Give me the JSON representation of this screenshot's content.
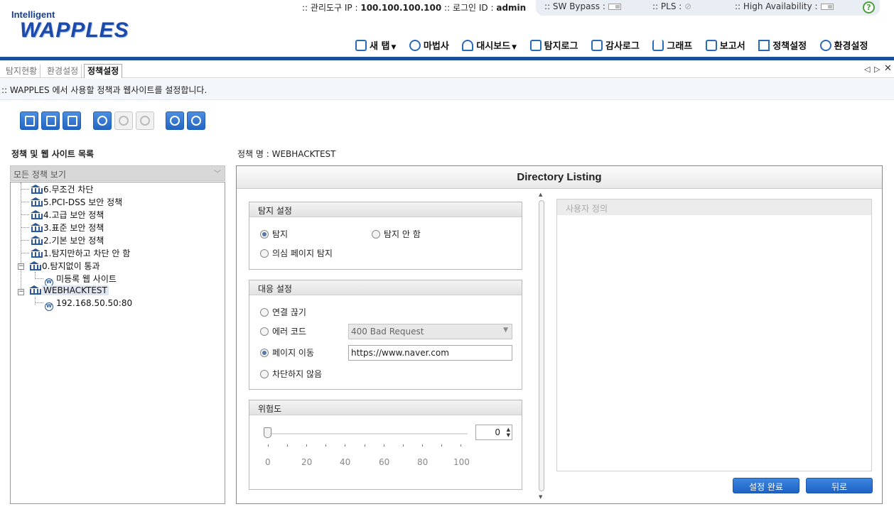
{
  "header": {
    "logo_top": "Intelligent",
    "logo_main": "WAPPLES",
    "admin_ip_label": "관리도구 IP :",
    "admin_ip": "100.100.100.100",
    "login_label": "로그인 ID :",
    "login_id": "admin",
    "sw_bypass": "SW Bypass :",
    "pls": "PLS :",
    "ha": "High Availability :",
    "help": "?"
  },
  "menu": {
    "new_tab": "새 탭",
    "wizard": "마법사",
    "dashboard": "대시보드",
    "detect_log": "탐지로그",
    "audit_log": "감사로그",
    "graph": "그래프",
    "report": "보고서",
    "policy": "정책설정",
    "env": "환경설정"
  },
  "tabs": {
    "t1": "탐지현황",
    "t2": "환경설정",
    "t3": "정책설정"
  },
  "description": ":: WAPPLES 에서 사용할 정책과 웹사이트를 설정합니다.",
  "left": {
    "title": "정책 및 웹 사이트 목록",
    "view_all": "모든 정책 보기",
    "tree": {
      "p6": "6.무조건 차단",
      "p5": "5.PCI-DSS 보안 정책",
      "p4": "4.고급 보안 정책",
      "p3": "3.표준 보안 정책",
      "p2": "2.기본 보안 정책",
      "p1": "1.탐지만하고 차단 안 함",
      "p0": "0.탐지없이 통과",
      "p0_site": "미등록 웹 사이트",
      "custom": "WEBHACKTEST",
      "custom_site": "192.168.50.50:80"
    }
  },
  "right": {
    "policy_name": "정책 명 : WEBHACKTEST",
    "panel_title": "Directory Listing",
    "detect": {
      "head": "탐지 설정",
      "opt_detect": "탐지",
      "opt_no_detect": "탐지 안 함",
      "opt_suspicious": "의심 페이지 탐지"
    },
    "response": {
      "head": "대응 설정",
      "opt_disconnect": "연결 끊기",
      "opt_error": "에러 코드",
      "error_value": "400 Bad Request",
      "opt_redirect": "페이지 이동",
      "redirect_url": "https://www.naver.com",
      "opt_no_block": "차단하지 않음"
    },
    "risk": {
      "head": "위험도",
      "value": "0",
      "ticks": [
        "0",
        "20",
        "40",
        "60",
        "80",
        "100"
      ]
    },
    "user_defined": "사용자 정의",
    "btn_done": "설정 완료",
    "btn_back": "뒤로"
  }
}
